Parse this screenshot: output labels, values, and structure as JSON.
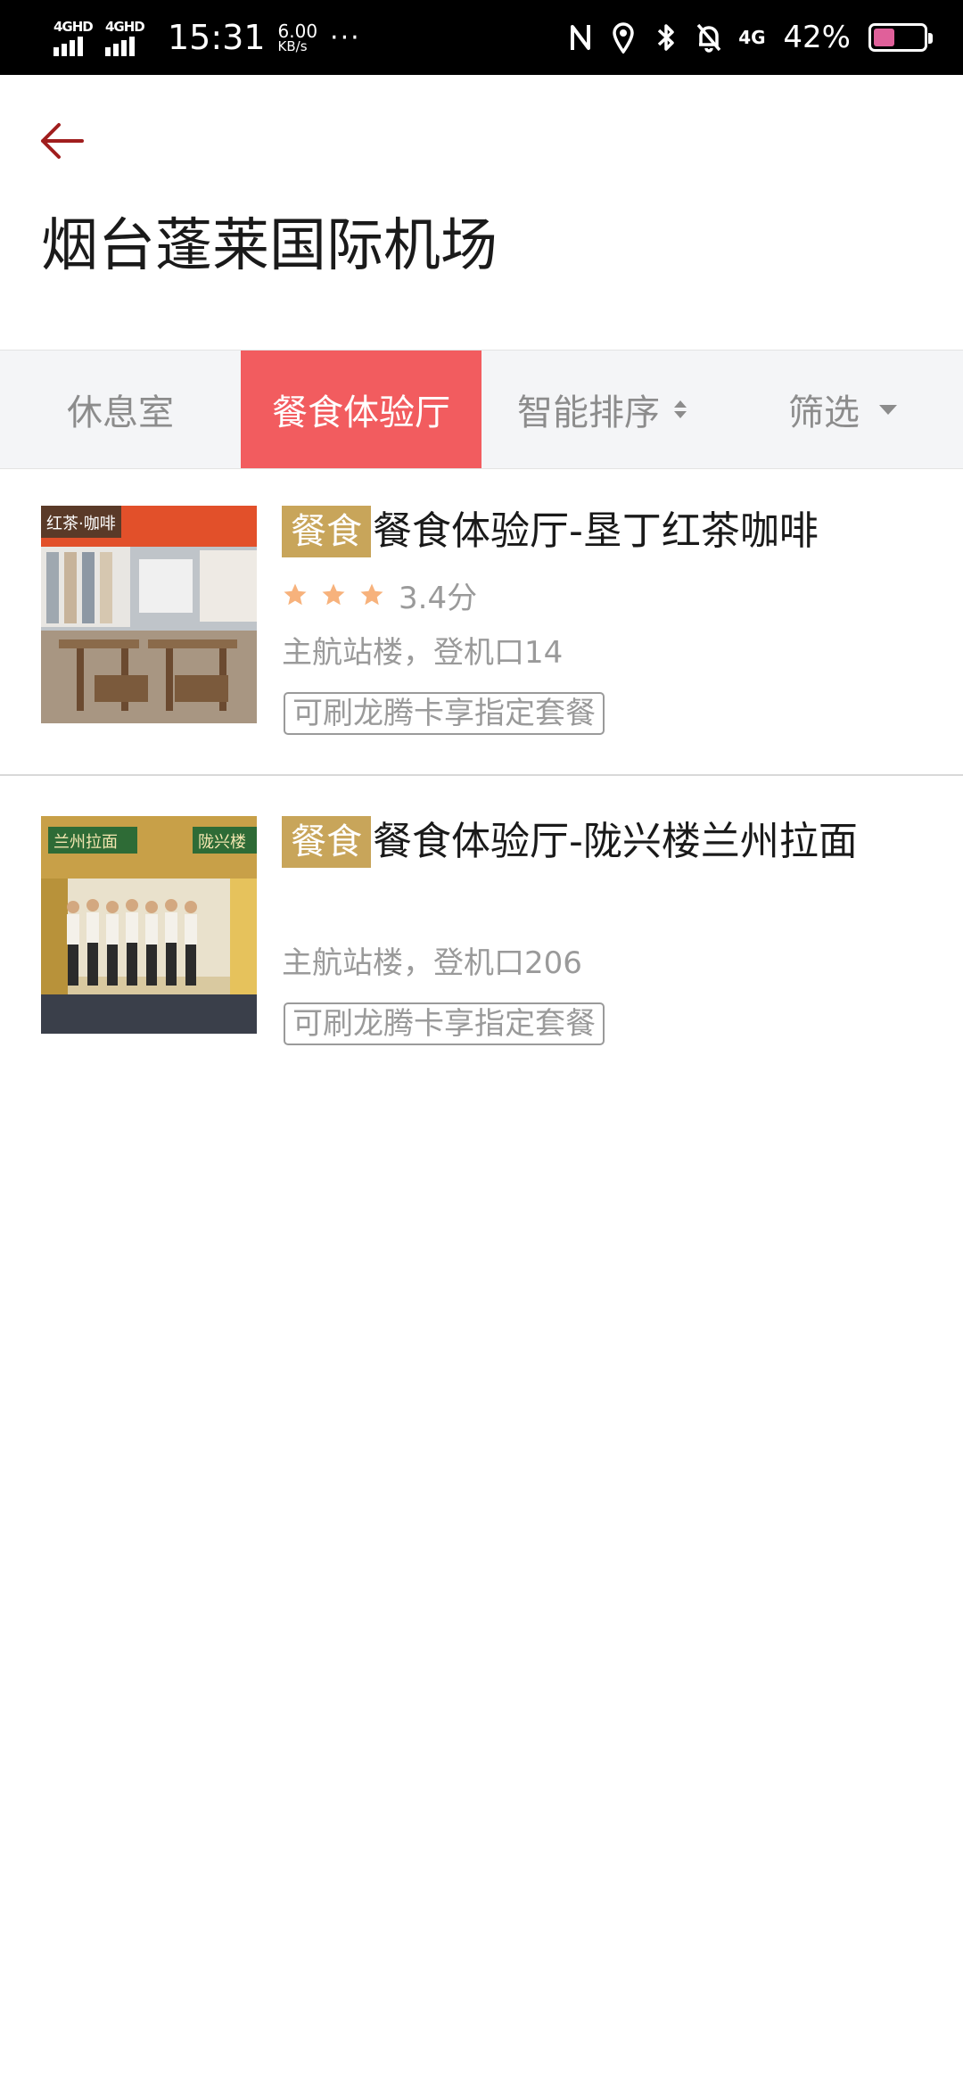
{
  "status_bar": {
    "sim1_label": "4GHD",
    "sim2_label": "4GHD",
    "time": "15:31",
    "speed_value": "6.00",
    "speed_unit": "KB/s",
    "more": "···",
    "net_label": "4G",
    "battery_percent": "42%",
    "battery_level": 0.42,
    "battery_color": "#e0609a",
    "icons": [
      "nfc-icon",
      "location-icon",
      "bluetooth-icon",
      "mute-bell-icon",
      "4g-data-icon",
      "battery-icon"
    ]
  },
  "header": {
    "back_icon": "arrow-left-icon",
    "back_color": "#a01e1e",
    "title": "烟台蓬莱国际机场"
  },
  "tabs": [
    {
      "label": "休息室",
      "active": false
    },
    {
      "label": "餐食体验厅",
      "active": true
    },
    {
      "label": "智能排序",
      "active": false,
      "icon": "sort-updown-icon"
    },
    {
      "label": "筛选",
      "active": false,
      "icon": "caret-down-icon"
    }
  ],
  "colors": {
    "accent": "#f25c5f",
    "badge": "#c8a55a",
    "star": "#f7b27c",
    "muted_text": "#9a9a9a",
    "tab_bg": "#f4f5f7"
  },
  "listings": [
    {
      "category": "餐食",
      "name": "餐食体验厅-垦丁红茶咖啡",
      "rating_stars": 3,
      "rating_text": "3.4分",
      "location": "主航站楼，登机口14",
      "tag": "可刷龙腾卡享指定套餐",
      "image_sign": "红茶·咖啡"
    },
    {
      "category": "餐食",
      "name": "餐食体验厅-陇兴楼兰州拉面",
      "location": "主航站楼，登机口206",
      "tag": "可刷龙腾卡享指定套餐",
      "image_sign_left": "兰州拉面",
      "image_sign_right": "陇兴楼"
    }
  ]
}
